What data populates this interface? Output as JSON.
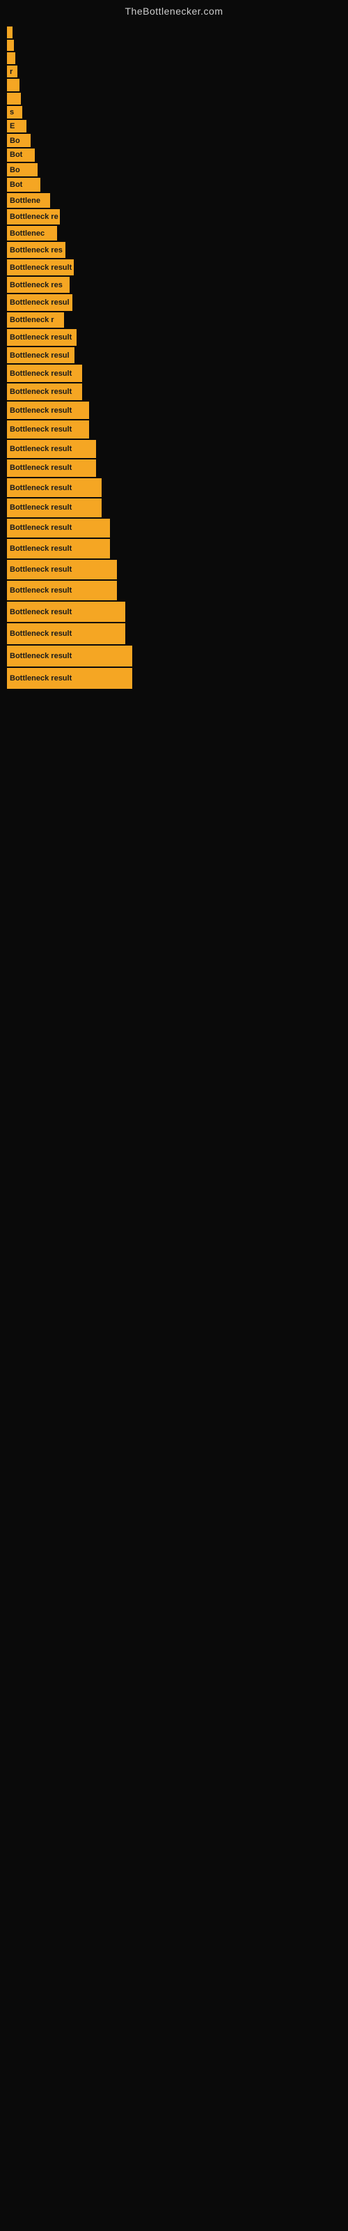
{
  "site": {
    "title": "TheBottlenecker.com"
  },
  "bars": [
    {
      "id": 1,
      "width": 8,
      "label": ""
    },
    {
      "id": 2,
      "width": 10,
      "label": ""
    },
    {
      "id": 3,
      "width": 12,
      "label": ""
    },
    {
      "id": 4,
      "width": 15,
      "label": "r"
    },
    {
      "id": 5,
      "width": 18,
      "label": ""
    },
    {
      "id": 6,
      "width": 20,
      "label": ""
    },
    {
      "id": 7,
      "width": 22,
      "label": "s"
    },
    {
      "id": 8,
      "width": 28,
      "label": "E"
    },
    {
      "id": 9,
      "width": 34,
      "label": "Bo"
    },
    {
      "id": 10,
      "width": 40,
      "label": "Bot"
    },
    {
      "id": 11,
      "width": 44,
      "label": "Bo"
    },
    {
      "id": 12,
      "width": 48,
      "label": "Bot"
    },
    {
      "id": 13,
      "width": 62,
      "label": "Bottlene"
    },
    {
      "id": 14,
      "width": 76,
      "label": "Bottleneck re"
    },
    {
      "id": 15,
      "width": 72,
      "label": "Bottlenec"
    },
    {
      "id": 16,
      "width": 84,
      "label": "Bottleneck res"
    },
    {
      "id": 17,
      "width": 96,
      "label": "Bottleneck result"
    },
    {
      "id": 18,
      "width": 90,
      "label": "Bottleneck res"
    },
    {
      "id": 19,
      "width": 94,
      "label": "Bottleneck resul"
    },
    {
      "id": 20,
      "width": 82,
      "label": "Bottleneck r"
    },
    {
      "id": 21,
      "width": 100,
      "label": "Bottleneck result"
    },
    {
      "id": 22,
      "width": 97,
      "label": "Bottleneck resul"
    },
    {
      "id": 23,
      "width": 108,
      "label": "Bottleneck result"
    },
    {
      "id": 24,
      "width": 108,
      "label": "Bottleneck result"
    },
    {
      "id": 25,
      "width": 118,
      "label": "Bottleneck result"
    },
    {
      "id": 26,
      "width": 118,
      "label": "Bottleneck result"
    },
    {
      "id": 27,
      "width": 128,
      "label": "Bottleneck result"
    },
    {
      "id": 28,
      "width": 128,
      "label": "Bottleneck result"
    },
    {
      "id": 29,
      "width": 136,
      "label": "Bottleneck result"
    },
    {
      "id": 30,
      "width": 136,
      "label": "Bottleneck result"
    },
    {
      "id": 31,
      "width": 148,
      "label": "Bottleneck result"
    },
    {
      "id": 32,
      "width": 148,
      "label": "Bottleneck result"
    },
    {
      "id": 33,
      "width": 158,
      "label": "Bottleneck result"
    },
    {
      "id": 34,
      "width": 158,
      "label": "Bottleneck result"
    },
    {
      "id": 35,
      "width": 170,
      "label": "Bottleneck result"
    },
    {
      "id": 36,
      "width": 170,
      "label": "Bottleneck result"
    },
    {
      "id": 37,
      "width": 180,
      "label": "Bottleneck result"
    },
    {
      "id": 38,
      "width": 180,
      "label": "Bottleneck result"
    }
  ]
}
